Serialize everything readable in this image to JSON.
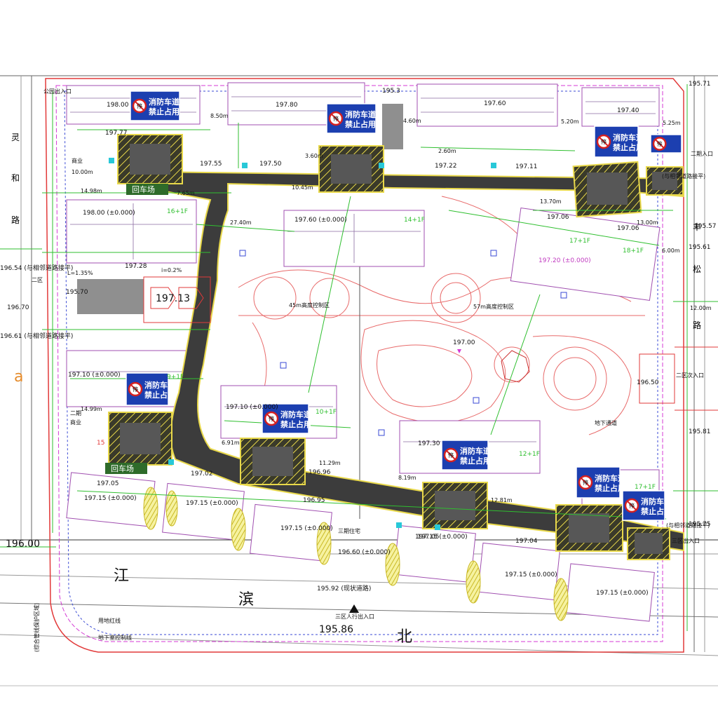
{
  "title_marks": {
    "corner_a": "a"
  },
  "roads": {
    "jiang": "江",
    "bin": "滨",
    "bei": "北",
    "west": [
      "灵",
      "和",
      "路"
    ],
    "east": [
      "丰",
      "松",
      "路"
    ]
  },
  "turnaround_labels": [
    "回车场",
    "回车场"
  ],
  "fire_sign": {
    "line1": "消防车道",
    "line2": "禁止占用",
    "symbol": "停"
  },
  "elevations": {
    "e1": "198.00",
    "e2": "197.80",
    "e3": "197.60",
    "e4": "197.40",
    "e5": "197.77",
    "e6": "197.55",
    "e7": "197.50",
    "e8": "197.22",
    "e9": "197.11",
    "e10": "198.00 (±0.000)",
    "e11": "197.60 (±0.000)",
    "e12": "197.06",
    "e13": "197.06",
    "e14": "197.20 (±0.000)",
    "e15": "197.28",
    "e16": "197.13",
    "e17": "197.00",
    "e18": "197.10 (±0.000)",
    "e19": "197.10 (±0.000)",
    "e20": "197.30",
    "e21": "197.02",
    "e22": "196.96",
    "e23": "196.95",
    "e24": "197.05",
    "e25": "197.04",
    "e26": "197.15 (±0.000)",
    "e27": "197.15 (±0.000)",
    "e28": "197.15 (±0.000)",
    "e29": "197.15 (±0.000)",
    "e30": "197.15 (±0.000)",
    "e31": "197.15 (±0.000)",
    "e32": "196.60 (±0.000)",
    "e33": "196.50",
    "e34": "196.00",
    "e35": "195.86",
    "e36": "195.92 (现状道路)",
    "e37": "195.71",
    "e38": "195.61",
    "e39": "195.75",
    "e40": "195.81",
    "e41": "195.57",
    "e42": "196.54 (与相邻道路接平)",
    "e43": "196.70",
    "e44": "196.61 (与相邻道路接平)",
    "e45": "197.05",
    "e46": "195.70",
    "e47": "195.3"
  },
  "dims": {
    "d1": "8.50m",
    "d2": "4.60m",
    "d3": "10.00m",
    "d4": "14.98m",
    "d5": "7.65m",
    "d6": "27.40m",
    "d7": "10.45m",
    "d8": "13.70m",
    "d9": "13.00m",
    "d10": "12.00m",
    "d11": "6.91m",
    "d12": "11.29m",
    "d13": "12.81m",
    "d14": "14.99m",
    "d15": "8.19m",
    "d16": "2.60m",
    "d17": "5.25m",
    "d18": "5.20m",
    "d19": "3.60m",
    "d20": "6.00m"
  },
  "floor_tags": {
    "f1": "16+1F",
    "f2": "14+1F",
    "f3": "17+1F",
    "f4": "18+1F",
    "f5": "9+1F",
    "f6": "10+1F",
    "f7": "12+1F",
    "f8": "17+1F",
    "f9": "15"
  },
  "notes": {
    "n1": "45m高度控制区",
    "n2": "57m高度控制区",
    "n3": "地下通道",
    "n4": "二区次入口",
    "n5": "三区出入口",
    "n6": "三区人行出入口",
    "n7": "(与相邻道路接平)",
    "n8": "(与相邻道路接平)",
    "n9": "用地红线",
    "n10": "地下室控制线",
    "n11": "(综合管线保护区域)",
    "n12": "二区",
    "n13": "商业",
    "n14": "商业",
    "n15": "二期",
    "n16": "公园出入口",
    "n17": "二期入口",
    "n18": "三期住宅",
    "n19": "L=1.35%",
    "n20": "i=0.2%"
  },
  "colors": {
    "fire_lane_fill": "#3c3c3c",
    "hatch_yellow": "#e8d84a",
    "sign_blue": "#1c3fb0",
    "boundary_red": "#e23a3a",
    "green_line": "#2fbf2f",
    "magenta": "#d43ad4",
    "cyan": "#28c8d8"
  }
}
